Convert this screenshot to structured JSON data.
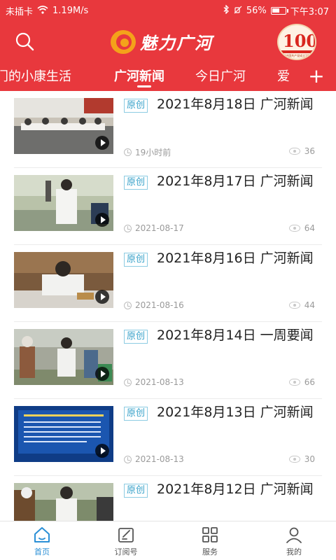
{
  "status_bar": {
    "sim": "未插卡",
    "speed": "1.19M/s",
    "battery": "56%",
    "battery_level": 0.56,
    "time": "下午3:07"
  },
  "header": {
    "title": "魅力广河",
    "badge_number": "100",
    "badge_caption": "庆祝中国共产党成立100周年",
    "brand_color": "#e8383d"
  },
  "tabs": [
    {
      "label": "门的小康生活"
    },
    {
      "label": "广河新闻",
      "active": true
    },
    {
      "label": "今日广河"
    },
    {
      "label": "爱"
    }
  ],
  "tab_add": "+",
  "news": [
    {
      "tag": "原创",
      "title": "2021年8月18日 广河新闻",
      "time": "19小时前",
      "views": "36"
    },
    {
      "tag": "原创",
      "title": "2021年8月17日 广河新闻",
      "time": "2021-08-17",
      "views": "64"
    },
    {
      "tag": "原创",
      "title": "2021年8月16日 广河新闻",
      "time": "2021-08-16",
      "views": "44"
    },
    {
      "tag": "原创",
      "title": "2021年8月14日 一周要闻",
      "time": "2021-08-13",
      "views": "66"
    },
    {
      "tag": "原创",
      "title": "2021年8月13日 广河新闻",
      "time": "2021-08-13",
      "views": "30"
    },
    {
      "tag": "原创",
      "title": "2021年8月12日 广河新闻",
      "time": "",
      "views": ""
    }
  ],
  "bottom_nav": [
    {
      "label": "首页",
      "icon": "home-icon",
      "active": true
    },
    {
      "label": "订阅号",
      "icon": "subscribe-icon"
    },
    {
      "label": "服务",
      "icon": "grid-icon"
    },
    {
      "label": "我的",
      "icon": "user-icon"
    }
  ],
  "colors": {
    "accent": "#e8383d",
    "tag_blue": "#36a1c9",
    "nav_active": "#2a8fd6"
  }
}
